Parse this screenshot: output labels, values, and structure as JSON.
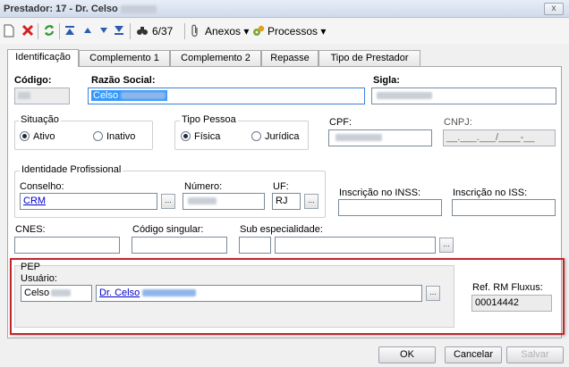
{
  "window": {
    "title": "Prestador: 17 - Dr. Celso",
    "close": "x"
  },
  "toolbar": {
    "counter": "6/37",
    "anexos": "Anexos",
    "processos": "Processos",
    "arrow": "▾"
  },
  "tabs": [
    "Identificação",
    "Complemento 1",
    "Complemento 2",
    "Repasse",
    "Tipo de Prestador"
  ],
  "form": {
    "codigo_label": "Código:",
    "razao_label": "Razão Social:",
    "razao_value": "Celso",
    "sigla_label": "Sigla:",
    "situacao_label": "Situação",
    "ativo": "Ativo",
    "inativo": "Inativo",
    "tipo_pessoa_label": "Tipo Pessoa",
    "fisica": "Física",
    "juridica": "Jurídica",
    "cpf_label": "CPF:",
    "cnpj_label": "CNPJ:",
    "cnpj_mask": "__.___.___/____-__",
    "identidade_label": "Identidade Profissional",
    "conselho_label": "Conselho:",
    "conselho_value": "CRM",
    "numero_label": "Número:",
    "uf_label": "UF:",
    "uf_value": "RJ",
    "inss_label": "Inscrição no INSS:",
    "iss_label": "Inscrição no ISS:",
    "cnes_label": "CNES:",
    "codigo_singular_label": "Código singular:",
    "sub_especialidade_label": "Sub especialidade:",
    "ellipsis": "..."
  },
  "pep": {
    "label": "PEP",
    "usuario_label": "Usuário:",
    "usuario_code": "Celso",
    "usuario_name": "Dr. Celso",
    "ref_label": "Ref. RM Fluxus:",
    "ref_value": "00014442"
  },
  "buttons": {
    "ok": "OK",
    "cancelar": "Cancelar",
    "salvar": "Salvar"
  }
}
